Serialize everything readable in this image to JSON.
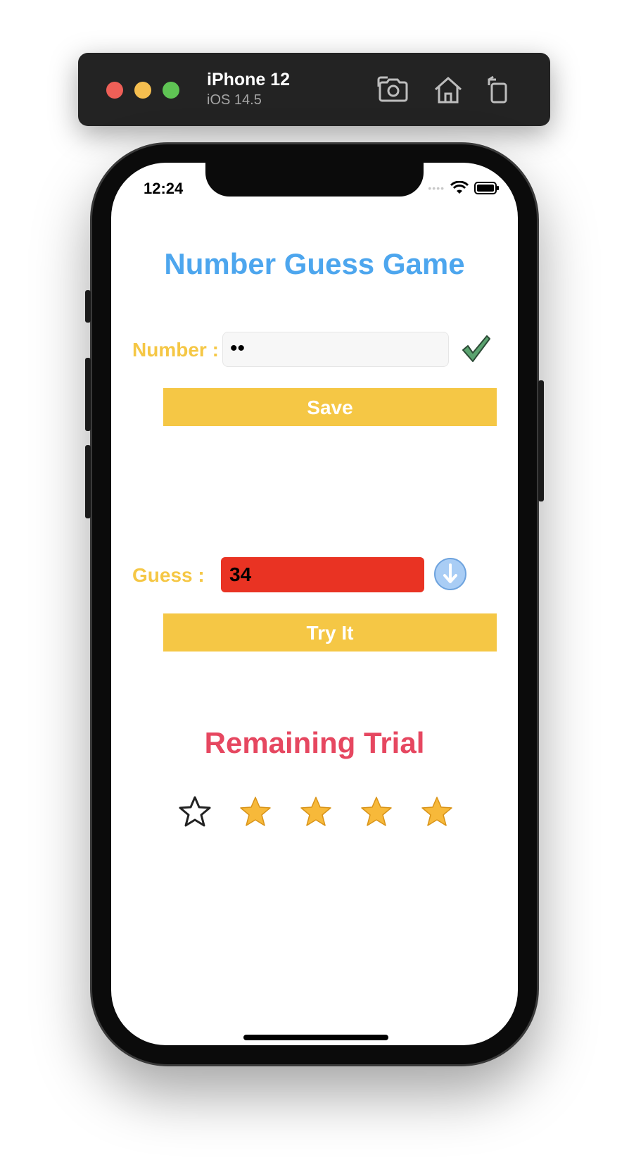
{
  "simulator": {
    "device_name": "iPhone 12",
    "os_version": "iOS 14.5",
    "icons": [
      "screenshot-icon",
      "home-icon",
      "rotate-icon"
    ]
  },
  "status_bar": {
    "time": "12:24"
  },
  "app": {
    "title": "Number Guess Game",
    "number_label": "Number :",
    "number_value": "••",
    "save_label": "Save",
    "guess_label": "Guess :",
    "guess_value": "34",
    "try_label": "Try It",
    "remaining_title": "Remaining Trial",
    "remaining_trials": 4,
    "total_trials": 5
  },
  "colors": {
    "title_blue": "#4da6ee",
    "accent_yellow": "#f5c745",
    "guess_field_red": "#e93323",
    "remaining_red": "#e64760",
    "check_green": "#5aa36f",
    "hint_blue": "#a9cdf5"
  }
}
